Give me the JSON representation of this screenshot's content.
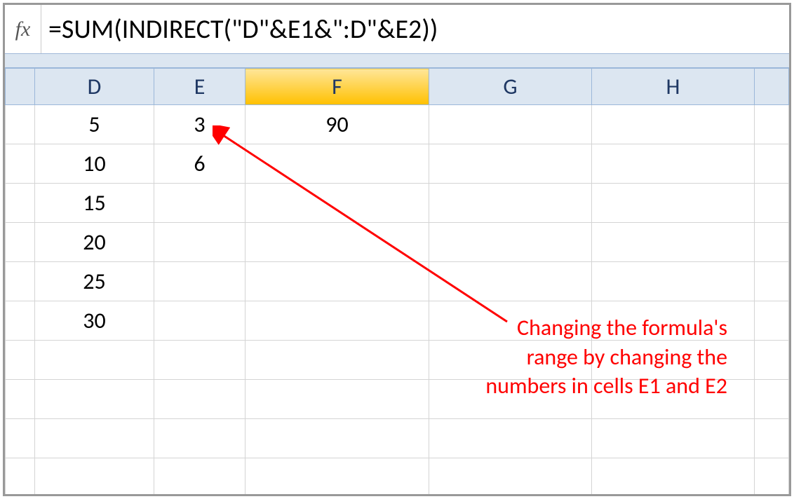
{
  "formula_bar": {
    "fx_label": "fx",
    "formula": "=SUM(INDIRECT(\"D\"&E1&\":D\"&E2))"
  },
  "columns": [
    "D",
    "E",
    "F",
    "G",
    "H"
  ],
  "selected_column": "F",
  "selected_cell": "F1",
  "cells": {
    "D1": "5",
    "D2": "10",
    "D3": "15",
    "D4": "20",
    "D5": "25",
    "D6": "30",
    "E1": "3",
    "E2": "6",
    "F1": "90"
  },
  "annotation": {
    "line1": "Changing the formula's",
    "line2": "range by changing the",
    "line3": "numbers in cells E1 and E2"
  }
}
